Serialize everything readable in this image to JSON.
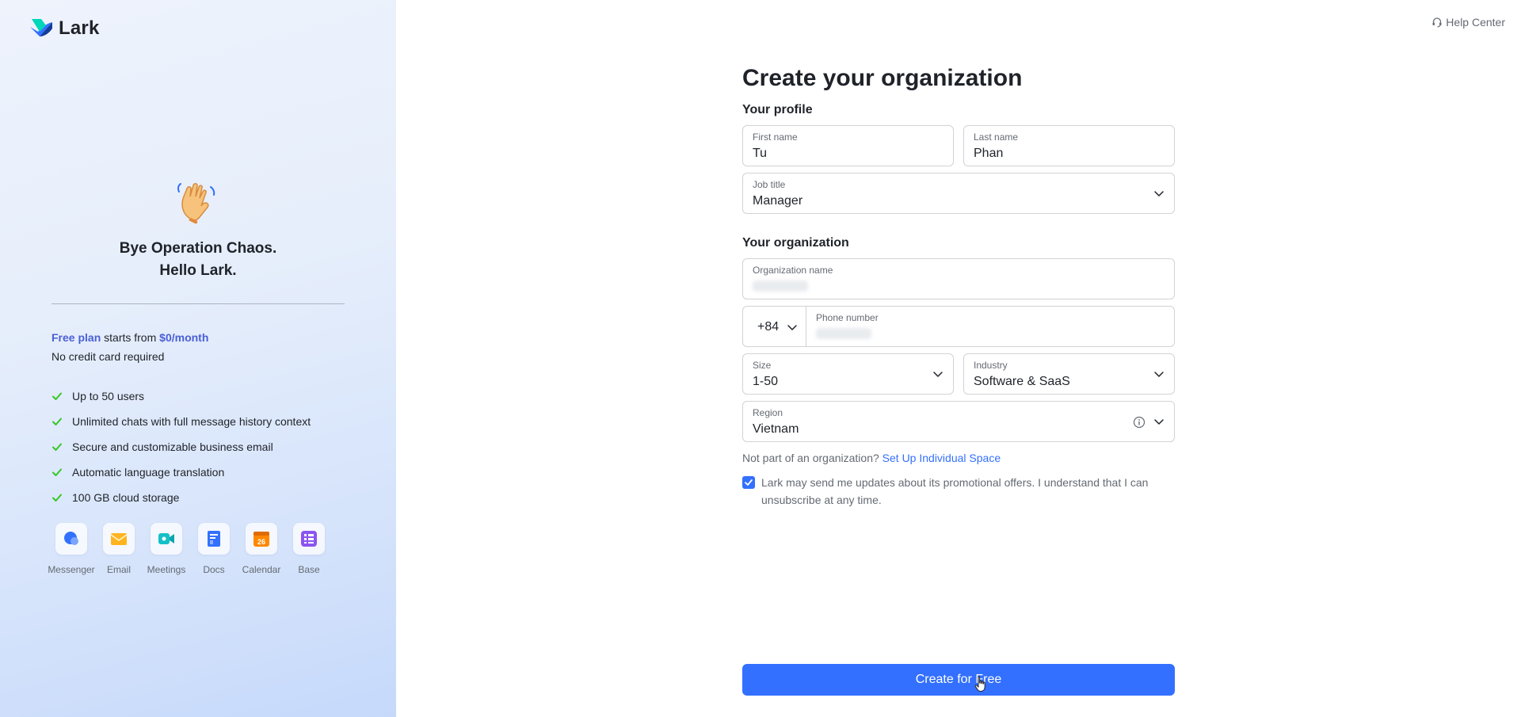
{
  "brand": {
    "name": "Lark"
  },
  "help": {
    "label": "Help Center"
  },
  "promo": {
    "line1": "Bye Operation Chaos.",
    "line2": "Hello Lark.",
    "plan_prefix": "Free plan",
    "plan_middle": " starts from ",
    "plan_price": "$0/month",
    "no_card": "No credit card required",
    "features": [
      "Up to 50 users",
      "Unlimited chats with full message history context",
      "Secure and customizable business email",
      "Automatic language translation",
      "100 GB cloud storage"
    ],
    "apps": [
      {
        "label": "Messenger",
        "icon": "messenger-icon"
      },
      {
        "label": "Email",
        "icon": "email-icon"
      },
      {
        "label": "Meetings",
        "icon": "meetings-icon"
      },
      {
        "label": "Docs",
        "icon": "docs-icon"
      },
      {
        "label": "Calendar",
        "icon": "calendar-icon"
      },
      {
        "label": "Base",
        "icon": "base-icon"
      }
    ],
    "calendar_day": "26"
  },
  "form": {
    "title": "Create your organization",
    "profile_heading": "Your profile",
    "first_name": {
      "label": "First name",
      "value": "Tu"
    },
    "last_name": {
      "label": "Last name",
      "value": "Phan"
    },
    "job_title": {
      "label": "Job title",
      "value": "Manager"
    },
    "org_heading": "Your organization",
    "org_name": {
      "label": "Organization name"
    },
    "phone": {
      "country_code": "+84",
      "label": "Phone number"
    },
    "size": {
      "label": "Size",
      "value": "1-50"
    },
    "industry": {
      "label": "Industry",
      "value": "Software & SaaS"
    },
    "region": {
      "label": "Region",
      "value": "Vietnam"
    },
    "not_part_text": "Not part of an organization? ",
    "not_part_link": "Set Up Individual Space",
    "consent_checked": true,
    "consent_text": "Lark may send me updates about its promotional offers. I understand that I can unsubscribe at any time.",
    "submit_label": "Create for Free"
  },
  "colors": {
    "accent": "#3370ff",
    "plan_highlight": "#4a5fd6",
    "check": "#34c724"
  }
}
